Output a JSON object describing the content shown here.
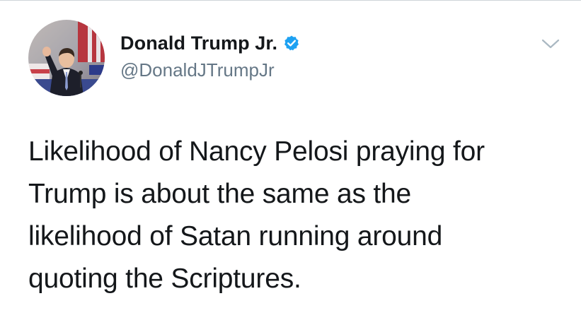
{
  "author": {
    "display_name": "Donald Trump Jr.",
    "handle": "@DonaldJTrumpJr",
    "verified": true
  },
  "tweet": {
    "text": "Likelihood of Nancy Pelosi praying for\nTrump is about the same as the\nlikelihood of Satan running around\nquoting the Scriptures."
  },
  "icons": {
    "verified": "verified-badge-icon",
    "menu": "chevron-down-icon"
  },
  "colors": {
    "verified_blue": "#1da1f2",
    "text_primary": "#14171a",
    "text_secondary": "#657786"
  }
}
